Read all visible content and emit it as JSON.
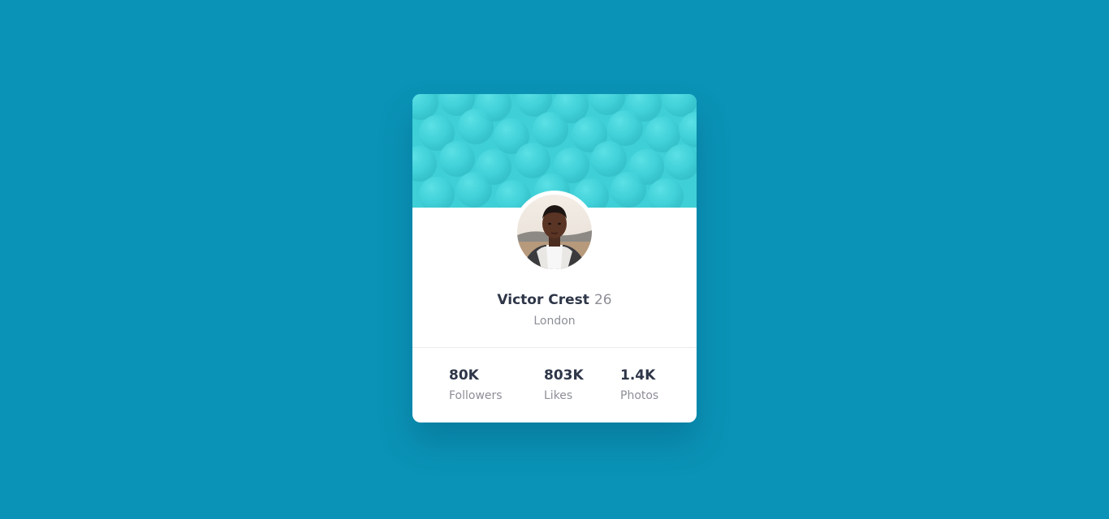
{
  "colors": {
    "background": "#0a93b6",
    "banner": "#3fcfd6",
    "card": "#ffffff",
    "name_text": "#2e3648",
    "muted_text": "#8d8f97"
  },
  "profile": {
    "name": "Victor Crest",
    "age": "26",
    "location": "London",
    "avatar_icon": "profile-photo"
  },
  "stats": [
    {
      "value": "80K",
      "label": "Followers"
    },
    {
      "value": "803K",
      "label": "Likes"
    },
    {
      "value": "1.4K",
      "label": "Photos"
    }
  ]
}
